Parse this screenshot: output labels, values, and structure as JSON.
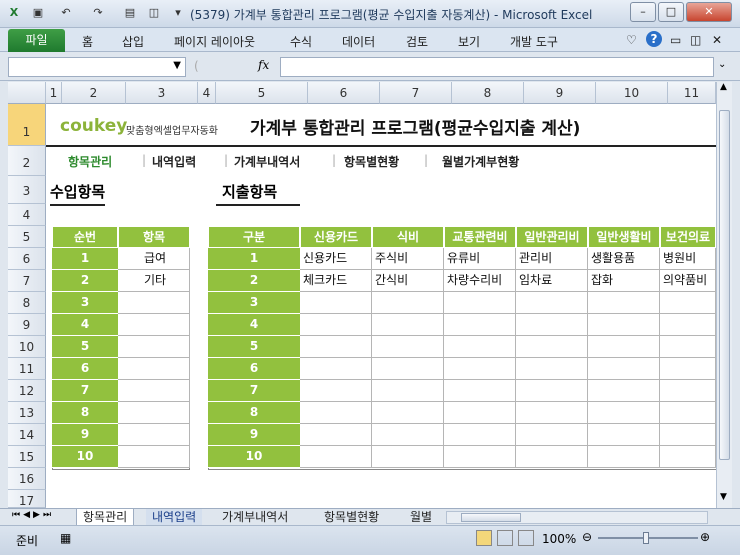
{
  "window": {
    "title": "(5379) 가계부 통합관리 프로그램(평균 수입지출 자동계산)  -  Microsoft Excel",
    "minimize": "–",
    "maximize": "□",
    "close": "✕"
  },
  "ribbon": {
    "file": "파일",
    "tabs": [
      "홈",
      "삽입",
      "페이지 레이아웃",
      "수식",
      "데이터",
      "검토",
      "보기",
      "개발 도구"
    ]
  },
  "formula_bar": {
    "name_box": "",
    "fx": "fx",
    "value": ""
  },
  "columns": [
    "1",
    "2",
    "3",
    "4",
    "5",
    "6",
    "7",
    "8",
    "9",
    "10",
    "11"
  ],
  "rows": [
    "1",
    "2",
    "3",
    "4",
    "5",
    "6",
    "7",
    "8",
    "9",
    "10",
    "11",
    "12",
    "13",
    "14",
    "15",
    "16",
    "17"
  ],
  "sheet": {
    "logo": "coukey",
    "logo_sub": "맞춤형엑셀업무자동화",
    "title": "가계부 통합관리 프로그램(평균수입지출 계산)",
    "nav": [
      "항목관리",
      "내역입력",
      "가계부내역서",
      "항목별현황",
      "월별가계부현황"
    ],
    "income_title": "수입항목",
    "expense_title": "지출항목",
    "income_headers": [
      "순번",
      "항목"
    ],
    "income_rows": [
      [
        "1",
        "급여"
      ],
      [
        "2",
        "기타"
      ],
      [
        "3",
        ""
      ],
      [
        "4",
        ""
      ],
      [
        "5",
        ""
      ],
      [
        "6",
        ""
      ],
      [
        "7",
        ""
      ],
      [
        "8",
        ""
      ],
      [
        "9",
        ""
      ],
      [
        "10",
        ""
      ]
    ],
    "expense_headers": [
      "구분",
      "신용카드",
      "식비",
      "교통관련비",
      "일반관리비",
      "일반생활비",
      "보건의료"
    ],
    "expense_rows": [
      [
        "1",
        "신용카드",
        "주식비",
        "유류비",
        "관리비",
        "생활용품",
        "병원비"
      ],
      [
        "2",
        "체크카드",
        "간식비",
        "차량수리비",
        "임차료",
        "잡화",
        "의약품비"
      ],
      [
        "3",
        "",
        "",
        "",
        "",
        "",
        ""
      ],
      [
        "4",
        "",
        "",
        "",
        "",
        "",
        ""
      ],
      [
        "5",
        "",
        "",
        "",
        "",
        "",
        ""
      ],
      [
        "6",
        "",
        "",
        "",
        "",
        "",
        ""
      ],
      [
        "7",
        "",
        "",
        "",
        "",
        "",
        ""
      ],
      [
        "8",
        "",
        "",
        "",
        "",
        "",
        ""
      ],
      [
        "9",
        "",
        "",
        "",
        "",
        "",
        ""
      ],
      [
        "10",
        "",
        "",
        "",
        "",
        "",
        ""
      ]
    ]
  },
  "sheet_tabs": [
    "항목관리",
    "내역입력",
    "가계부내역서",
    "항목별현황",
    "월별"
  ],
  "status": {
    "ready": "준비",
    "zoom": "100%"
  },
  "colors": {
    "green": "#92c13e",
    "nav_active": "#2e8b2e",
    "file_tab": "#1f7a2e"
  }
}
